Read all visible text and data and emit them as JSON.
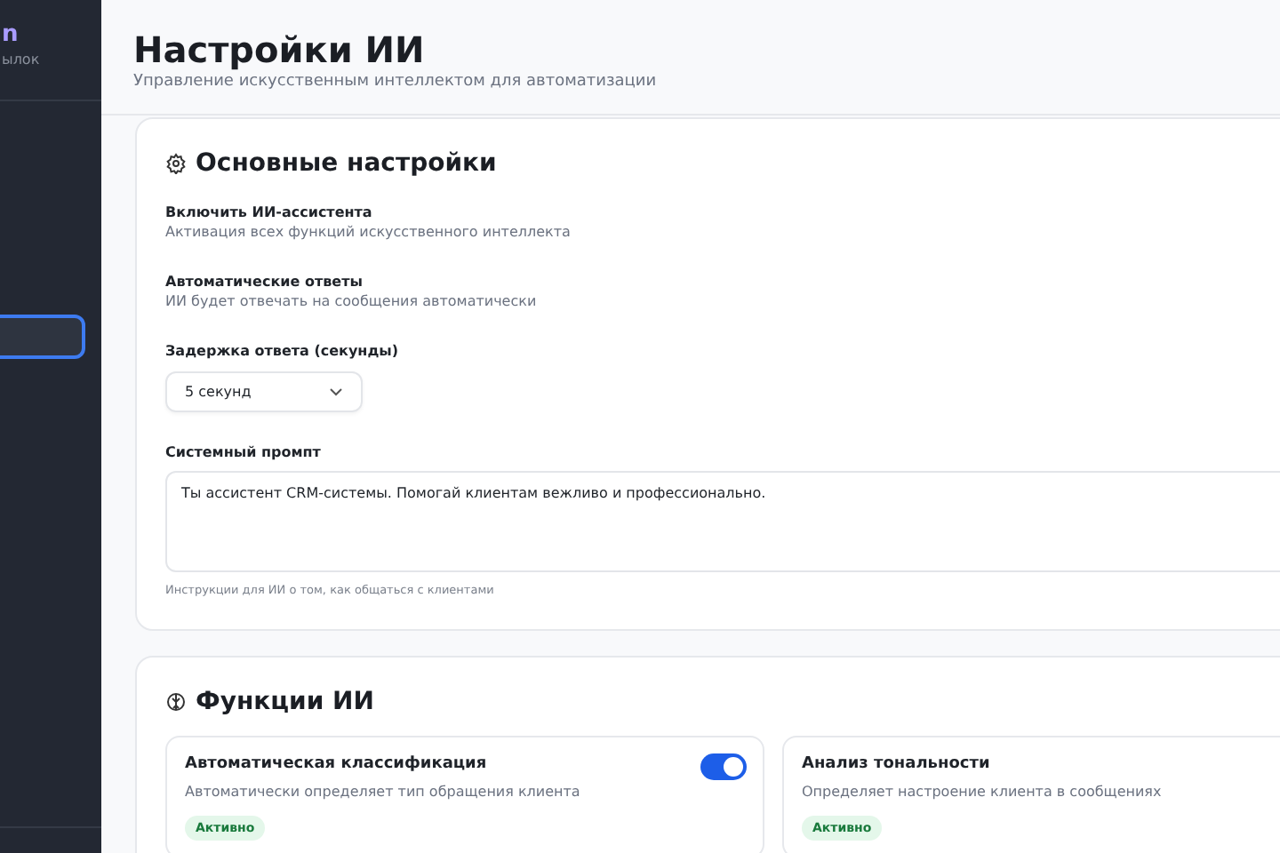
{
  "sidebar": {
    "brand": "n",
    "subtitle": "ылок",
    "items": [
      {
        "selected": true
      }
    ]
  },
  "header": {
    "title": "Настройки ИИ",
    "subtitle": "Управление искусственным интеллектом для автоматизации"
  },
  "basic_settings": {
    "title": "Основные настройки",
    "settings": [
      {
        "kind": "text",
        "label": "Включить ИИ-ассистента",
        "description": "Активация всех функций искусственного интеллекта"
      },
      {
        "kind": "text",
        "label": "Автоматические ответы",
        "description": "ИИ будет отвечать на сообщения автоматически"
      },
      {
        "kind": "select",
        "label": "Задержка ответа (секунды)",
        "value": "5 секунд"
      },
      {
        "kind": "textarea",
        "label": "Системный промпт",
        "value": "Ты ассистент CRM-системы. Помогай клиентам вежливо и профессионально.",
        "hint": "Инструкции для ИИ о том, как общаться с клиентами"
      }
    ]
  },
  "ai_functions": {
    "title": "Функции ИИ",
    "features": [
      {
        "title": "Автоматическая классификация",
        "description": "Автоматически определяет тип обращения клиента",
        "badge": "Активно",
        "on": true
      },
      {
        "title": "Анализ тональности",
        "description": "Определяет настроение клиента в сообщениях",
        "badge": "Активно"
      }
    ]
  }
}
